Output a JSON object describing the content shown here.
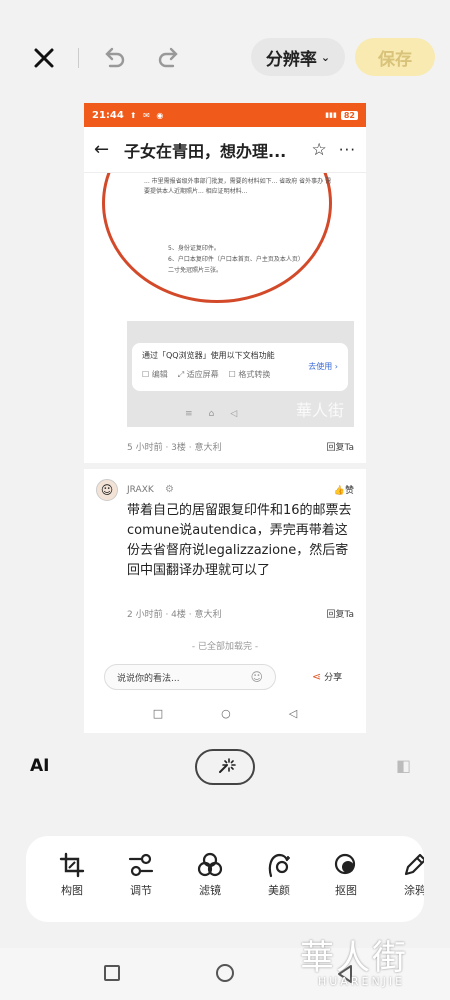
{
  "editor": {
    "resolution_label": "分辨率",
    "save_label": "保存",
    "ai_label": "AI",
    "tools": [
      {
        "label": "构图",
        "icon": "crop-icon"
      },
      {
        "label": "调节",
        "icon": "adjust-icon"
      },
      {
        "label": "滤镜",
        "icon": "filter-icon"
      },
      {
        "label": "美颜",
        "icon": "beauty-icon"
      },
      {
        "label": "抠图",
        "icon": "cutout-icon"
      },
      {
        "label": "涂鸦",
        "icon": "doodle-icon"
      }
    ]
  },
  "preview": {
    "status": {
      "time": "21:44",
      "battery": "82"
    },
    "header": {
      "title": "子女在青田，想办理..."
    },
    "doc_text": "... 市里需报省级外事部门批复，需要的材料如下... 省政府 省外事办 需要提供本人近期照片... 相应证明材料...",
    "doc_list": [
      "5、身份证复印件。",
      "6、户口本复印件（户口本首页、户主页及本人页）",
      "二寸免冠照片三张。"
    ],
    "qq_popup": {
      "line1": "通过「QQ浏览器」使用以下文档功能",
      "actions": [
        "编辑",
        "适应屏幕",
        "格式转换"
      ],
      "use": "去使用"
    },
    "post1_meta": "5 小时前 · 3楼 · 意大利",
    "reply_label": "回复Ta",
    "comment": {
      "user": "JRAXK",
      "like_label": "赞",
      "text": "带着自己的居留跟复印件和16的邮票去comune说autendica，弄完再带着这份去省督府说legalizzazione，然后寄回中国翻译办理就可以了",
      "meta": "2 小时前 · 4楼 · 意大利"
    },
    "loaded_text": "- 已全部加载完 -",
    "input_placeholder": "说说你的看法...",
    "share_label": "分享"
  },
  "watermark": {
    "big": "華人街",
    "small": "HUARENJIE"
  }
}
